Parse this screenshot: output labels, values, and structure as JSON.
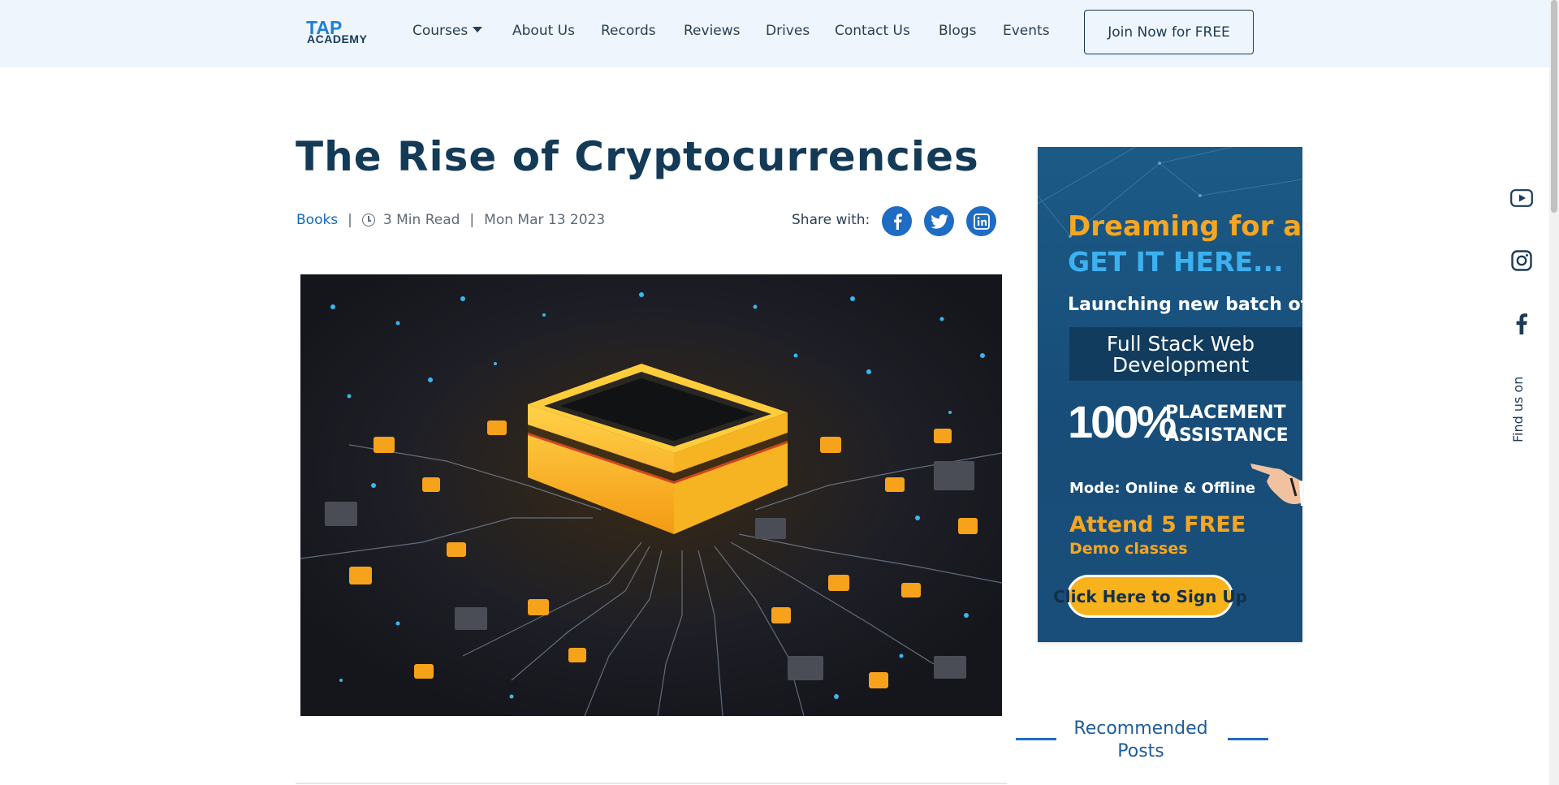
{
  "header": {
    "logo": {
      "line1": "TAP",
      "line2": "ACADEMY"
    },
    "nav": [
      {
        "label": "Courses",
        "has_dropdown": true
      },
      {
        "label": "About Us"
      },
      {
        "label": "Records"
      },
      {
        "label": "Reviews"
      },
      {
        "label": "Drives"
      },
      {
        "label": "Contact Us"
      },
      {
        "label": "Blogs"
      },
      {
        "label": "Events"
      }
    ],
    "join_label": "Join Now for FREE"
  },
  "article": {
    "title": "The Rise of Cryptocurrencies",
    "category": "Books",
    "read_time": "3 Min Read",
    "date": "Mon Mar 13 2023",
    "share_label": "Share with:",
    "share_icons": [
      "facebook-icon",
      "twitter-icon",
      "linkedin-icon"
    ]
  },
  "ad": {
    "line1": "Dreaming for a J",
    "line2": "GET IT HERE...",
    "line3": "Launching new batch of",
    "course_line1": "Full Stack Web",
    "course_line2": "Development",
    "percent": "100%",
    "placement1": "PLACEMENT",
    "placement2": "ASSISTANCE",
    "mode": "Mode: Online & Offline",
    "attend": "Attend 5 FREE",
    "demo": "Demo classes",
    "cta": "Click Here to Sign Up"
  },
  "recommended": {
    "title_line1": "Recommended",
    "title_line2": "Posts"
  },
  "side_social": {
    "icons": [
      "youtube-icon",
      "instagram-icon",
      "facebook-icon"
    ],
    "find_us": "Find us on"
  },
  "colors": {
    "header_bg": "#eef5fc",
    "title": "#133a56",
    "accent_blue": "#1e6cc4",
    "ad_orange": "#f5a623"
  }
}
